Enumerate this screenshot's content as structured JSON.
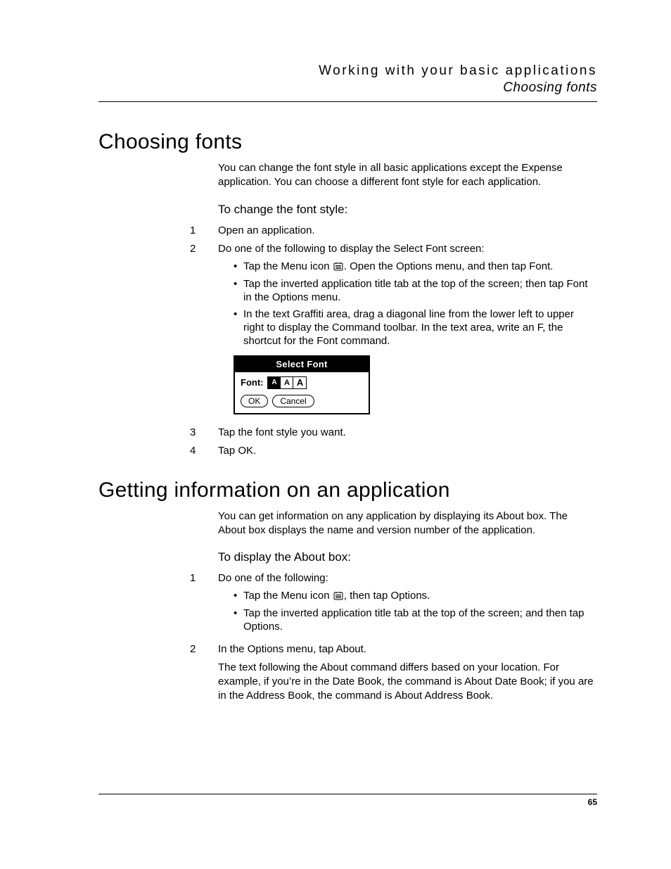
{
  "header": {
    "line1": "Working with your basic applications",
    "line2": "Choosing fonts"
  },
  "section1": {
    "title": "Choosing fonts",
    "intro": "You can change the font style in all basic applications except the Expense application. You can choose a different font style for each application.",
    "subhead": "To change the font style:",
    "steps": {
      "s1": "Open an application.",
      "s2": "Do one of the following to display the Select Font screen:",
      "b1a": "Tap the Menu icon ",
      "b1b": ". Open the Options menu, and then tap Font.",
      "b2": "Tap the inverted application title tab at the top of the screen; then tap Font in the Options menu.",
      "b3": "In the text Graffiti area, drag a diagonal line from the lower left to upper right to display the Command toolbar. In the text area, write an F, the shortcut for the Font command.",
      "s3": "Tap the font style you want.",
      "s4": "Tap OK."
    }
  },
  "dialog": {
    "title": "Select Font",
    "label": "Font:",
    "opts": {
      "a1": "A",
      "a2": "A",
      "a3": "A"
    },
    "ok": "OK",
    "cancel": "Cancel"
  },
  "section2": {
    "title": "Getting information on an application",
    "intro": "You can get information on any application by displaying its About box. The About box displays the name and version number of the application.",
    "subhead": "To display the About box:",
    "steps": {
      "s1": "Do one of the following:",
      "b1a": "Tap the Menu icon ",
      "b1b": ", then tap Options.",
      "b2": "Tap the inverted application title tab at the top of the screen; and then tap Options.",
      "s2": "In the Options menu, tap About.",
      "after": "The text following the About command differs based on your location. For example, if you’re in the Date Book, the command is About Date Book; if you are in the Address Book, the command is About Address Book."
    }
  },
  "page_number": "65"
}
